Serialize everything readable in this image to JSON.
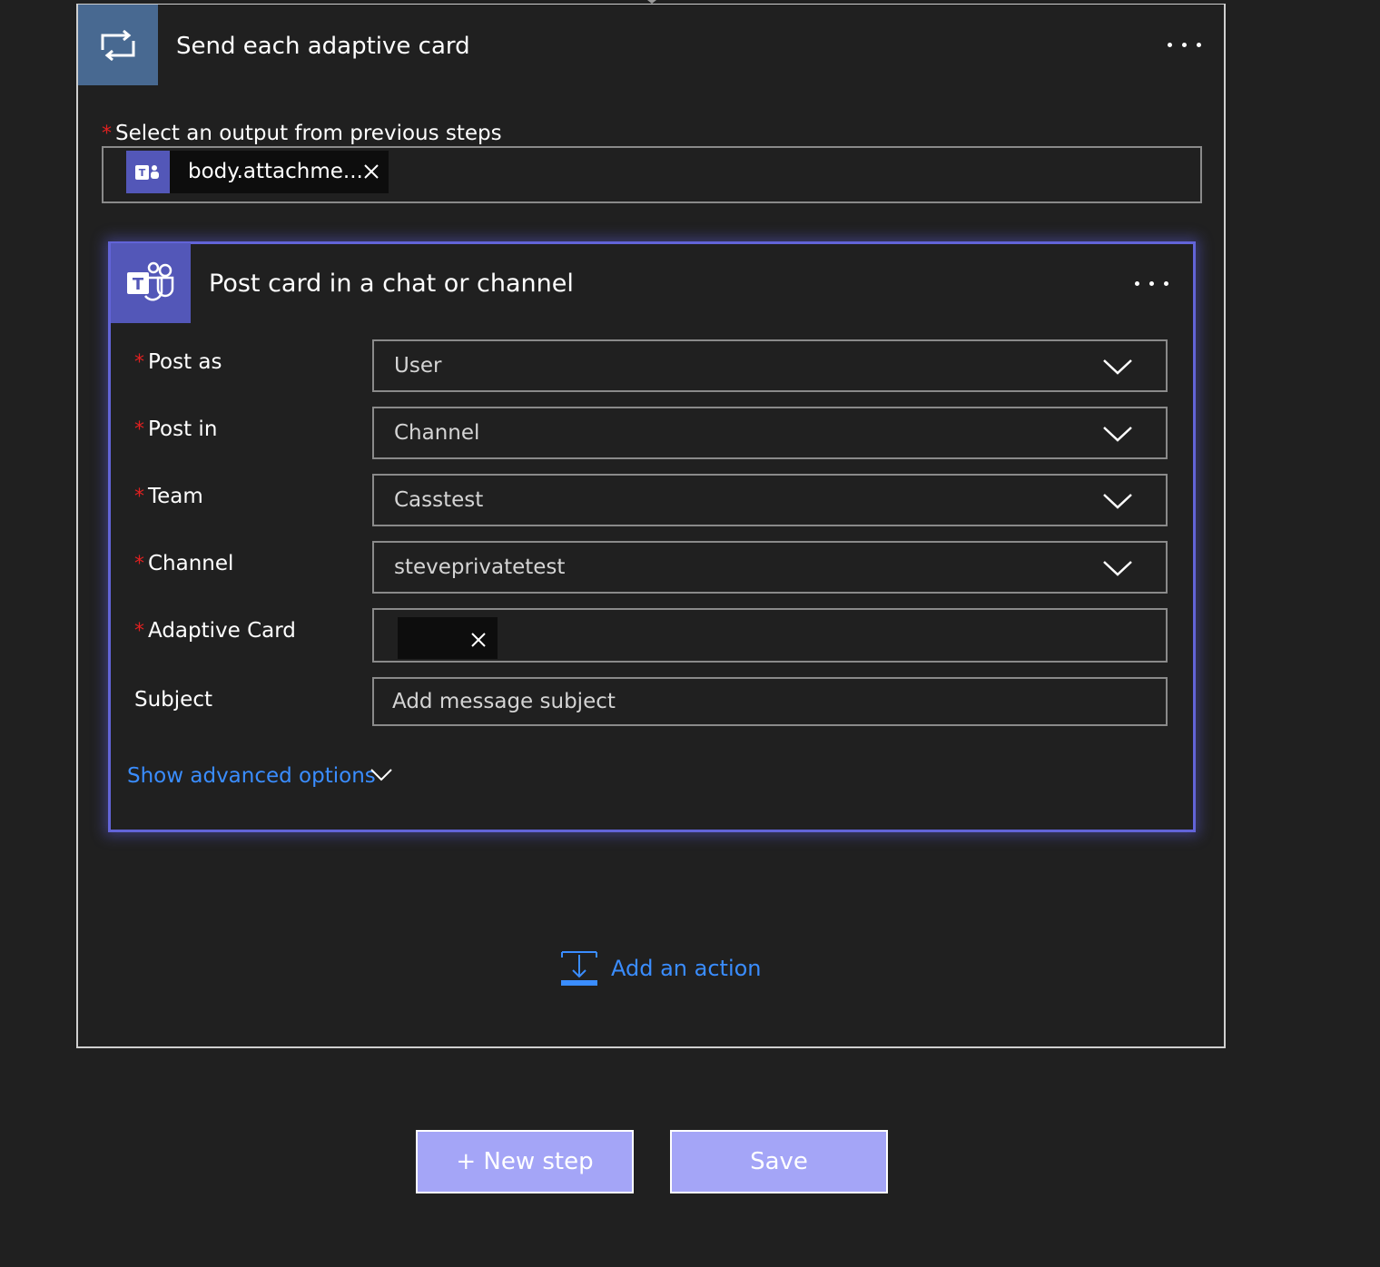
{
  "loop": {
    "title": "Send each adaptive card",
    "icon": "loop-icon",
    "output_label": "Select an output from previous steps",
    "output_token": {
      "text": "body.attachme...",
      "icon": "teams-icon"
    }
  },
  "action": {
    "title": "Post card in a chat or channel",
    "icon": "teams-icon",
    "fields": [
      {
        "label": "Post as",
        "required": true,
        "value": "User"
      },
      {
        "label": "Post in",
        "required": true,
        "value": "Channel"
      },
      {
        "label": "Team",
        "required": true,
        "value": "Casstest"
      },
      {
        "label": "Channel",
        "required": true,
        "value": "steveprivatetest"
      },
      {
        "label": "Adaptive Card",
        "required": true,
        "value": ""
      },
      {
        "label": "Subject",
        "required": false,
        "placeholder": "Add message subject"
      }
    ],
    "advanced_link": "Show advanced options"
  },
  "add_action_label": "Add an action",
  "buttons": {
    "new_step": "+ New step",
    "save": "Save"
  },
  "colors": {
    "background": "#202020",
    "loop_header": "#486991",
    "teams_accent": "#5357b8",
    "link": "#3a8dff",
    "button": "#a4a5f7",
    "required": "#e02020"
  }
}
